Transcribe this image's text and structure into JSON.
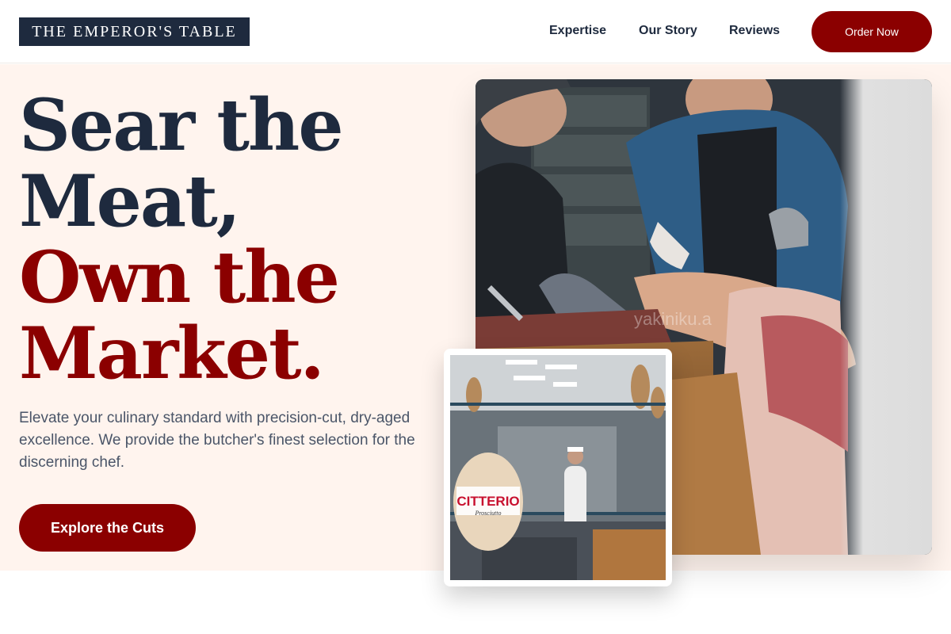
{
  "brand": {
    "name": "THE EMPEROR'S TABLE"
  },
  "nav": {
    "links": [
      "Expertise",
      "Our Story",
      "Reviews"
    ],
    "cta": "Order Now"
  },
  "hero": {
    "headline": [
      "Sear the",
      "Meat,",
      "Own the",
      "Market."
    ],
    "subtext": "Elevate your culinary standard with precision-cut, dry-aged excellence. We provide the butcher's finest selection for the discerning chef.",
    "cta": "Explore the Cuts"
  },
  "photos": {
    "main": {
      "watermark": "yakiniku.a"
    },
    "inset": {
      "sign_text": "CITTERIO",
      "sign_subtext": "Prosciutto"
    }
  },
  "colors": {
    "navy": "#1e2a3e",
    "brand_red": "#8b0000",
    "hero_bg": "#fff4ee",
    "body_text": "#4a5568"
  }
}
